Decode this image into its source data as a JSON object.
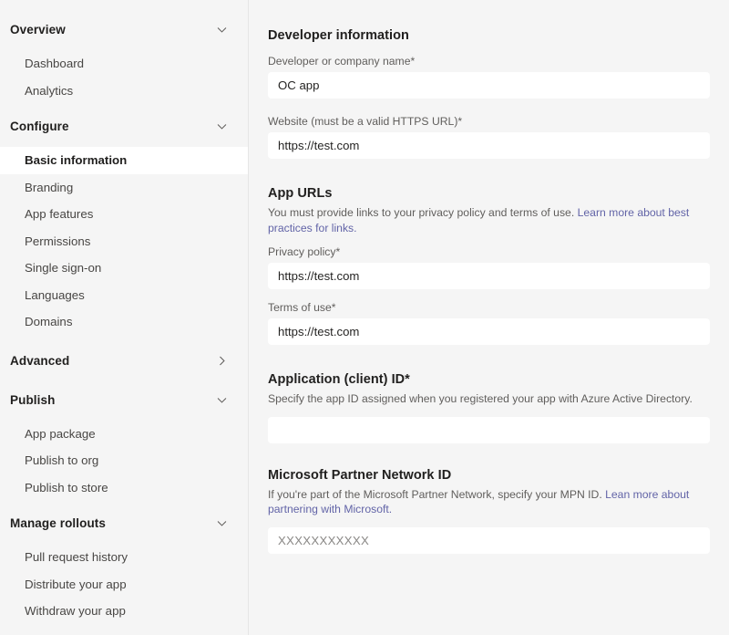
{
  "sidebar": {
    "groups": [
      {
        "label": "Overview",
        "icon": "chevron-down-icon",
        "expanded": true,
        "items": [
          {
            "label": "Dashboard",
            "selected": false
          },
          {
            "label": "Analytics",
            "selected": false
          }
        ]
      },
      {
        "label": "Configure",
        "icon": "chevron-down-icon",
        "expanded": true,
        "items": [
          {
            "label": "Basic information",
            "selected": true
          },
          {
            "label": "Branding",
            "selected": false
          },
          {
            "label": "App features",
            "selected": false
          },
          {
            "label": "Permissions",
            "selected": false
          },
          {
            "label": "Single sign-on",
            "selected": false
          },
          {
            "label": "Languages",
            "selected": false
          },
          {
            "label": "Domains",
            "selected": false
          }
        ]
      },
      {
        "label": "Advanced",
        "icon": "chevron-right-icon",
        "expanded": false,
        "items": []
      },
      {
        "label": "Publish",
        "icon": "chevron-down-icon",
        "expanded": true,
        "items": [
          {
            "label": "App package",
            "selected": false
          },
          {
            "label": "Publish to org",
            "selected": false
          },
          {
            "label": "Publish to store",
            "selected": false
          }
        ]
      },
      {
        "label": "Manage rollouts",
        "icon": "chevron-down-icon",
        "expanded": true,
        "items": [
          {
            "label": "Pull request history",
            "selected": false
          },
          {
            "label": "Distribute your app",
            "selected": false
          },
          {
            "label": "Withdraw your app",
            "selected": false
          }
        ]
      }
    ]
  },
  "main": {
    "developer_information": {
      "title": "Developer information",
      "company_name": {
        "label": "Developer or company name*",
        "value": "OC app"
      },
      "website": {
        "label": "Website (must be a valid HTTPS URL)*",
        "value": "https://test.com"
      }
    },
    "app_urls": {
      "title": "App URLs",
      "helper_text": "You must provide links to your privacy policy and terms of use. ",
      "helper_link": "Learn more about best practices for links.",
      "privacy_policy": {
        "label": "Privacy policy*",
        "value": "https://test.com"
      },
      "terms_of_use": {
        "label": "Terms of use*",
        "value": "https://test.com"
      }
    },
    "application_client_id": {
      "title": "Application (client) ID*",
      "helper_text": "Specify the app ID assigned when you registered your app with Azure Active Directory.",
      "value": ""
    },
    "mpn_id": {
      "title": "Microsoft Partner Network ID",
      "helper_text": "If you're part of the Microsoft Partner Network, specify your MPN ID. ",
      "helper_link": "Lean more about partnering with Microsoft.",
      "value": "XXXXXXXXXXX"
    }
  },
  "colors": {
    "page_background": "#f5f5f5",
    "selected_item_background": "#ffffff",
    "link": "#6264a7",
    "input_background": "#ffffff",
    "label_text": "#605e5c",
    "heading_text": "#201f1e"
  }
}
